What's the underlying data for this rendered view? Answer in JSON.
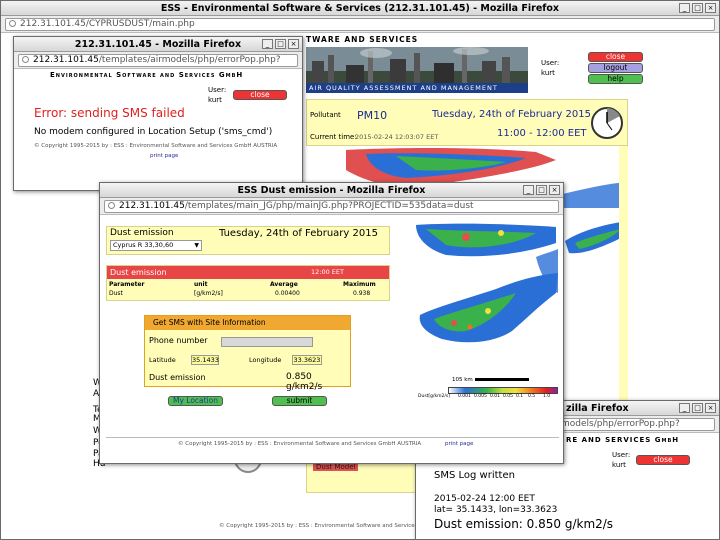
{
  "win_main": {
    "title": "ESS - Environmental Software & Services (212.31.101.45) - Mozilla Firefox",
    "url": "212.31.101.45/CYPRUSDUST/main.php",
    "org_partial": "TWARE AND SERVICES",
    "aqam": "AIR QUALITY ASSESSMENT AND MANAGEMENT",
    "user_label": "User:",
    "user_name": "kurt",
    "close": "close",
    "logout": "logout",
    "help": "help",
    "pollutant_label": "Pollutant",
    "pollutant": "PM10",
    "date": "Tuesday, 24th of February 2015",
    "current_label": "Current time:",
    "current_value": "2015-02-24 12:03:07 EET",
    "time_range": "11:00 - 12:00 EET",
    "copyright": "© Copyright 1995-2015 by : ESS : Environmental Software and Services GmbH AUSTRIA"
  },
  "win_err": {
    "title": "212.31.101.45 - Mozilla Firefox",
    "url_host": "212.31.101.45",
    "url_path": "/templates/airmodels/php/errorPop.php?",
    "org": "Environmental Software and Services GmbH",
    "user_label": "User:",
    "user_name": "kurt",
    "close": "close",
    "error_title": "Error: sending SMS failed",
    "error_msg": "No modem configured in Location Setup ('sms_cmd')",
    "copyright": "© Copyright 1995-2015 by : ESS : Environmental Software and Services GmbH AUSTRIA",
    "print": "print page"
  },
  "win_dust": {
    "title": "ESS Dust emission - Mozilla Firefox",
    "url_host": "212.31.101.45",
    "url_path": "/templates/main_JG/php/mainJG.php?PROJECTID=535data=dust",
    "panel_title": "Dust emission",
    "station": "Cyprus R 33,30,60",
    "date": "Tuesday, 24th of February 2015",
    "table_title": "Dust emission",
    "table_time": "12:00 EET",
    "headers": [
      "Parameter",
      "unit",
      "Average",
      "Maximum"
    ],
    "row": [
      "Dust",
      "[g/km2/s]",
      "0.00400",
      "0.938"
    ],
    "sms_title": "Get SMS with Site Information",
    "phone_label": "Phone number",
    "phone_value": "",
    "lat_label": "Latitude",
    "lat_value": "35.1433",
    "lon_label": "Longitude",
    "lon_value": "33.3623",
    "emis_label": "Dust emission",
    "emis_value": "0.850 g/km2/s",
    "mylocation": "My Location",
    "submit": "submit",
    "scale_label": "105 km",
    "legend_unit": "Dust[g/km2/s]",
    "legend_ticks": [
      "0.000",
      "0.001",
      "0.005",
      "0.01",
      "0.05",
      "0.1",
      "0.5",
      "1.0"
    ],
    "copyright": "© Copyright 1995-2015 by : ESS : Environmental Software and Services GmbH AUSTRIA",
    "print": "print page"
  },
  "win_sms": {
    "title": "zilla Firefox",
    "url_path": "models/php/errorPop.php?",
    "org": "RE AND SERVICES GmbH",
    "user_label": "User:",
    "user_name": "kurt",
    "close": "close",
    "log_title": "SMS Log written",
    "timestamp": "2015-02-24 12:00 EET",
    "coords": "lat= 35.1433, lon=33.3623",
    "emis": "Dust emission: 0.850 g/km2/s"
  },
  "bg_left": [
    "W",
    "Ar",
    "Te",
    "Mi",
    "W",
    "Pe",
    "Pa",
    "Hu"
  ],
  "bg_under": {
    "dust_model": "Dust Model"
  },
  "bottom_copyright": "© Copyright 1995-2015 by : ESS : Environmental Software and Services GmbH"
}
